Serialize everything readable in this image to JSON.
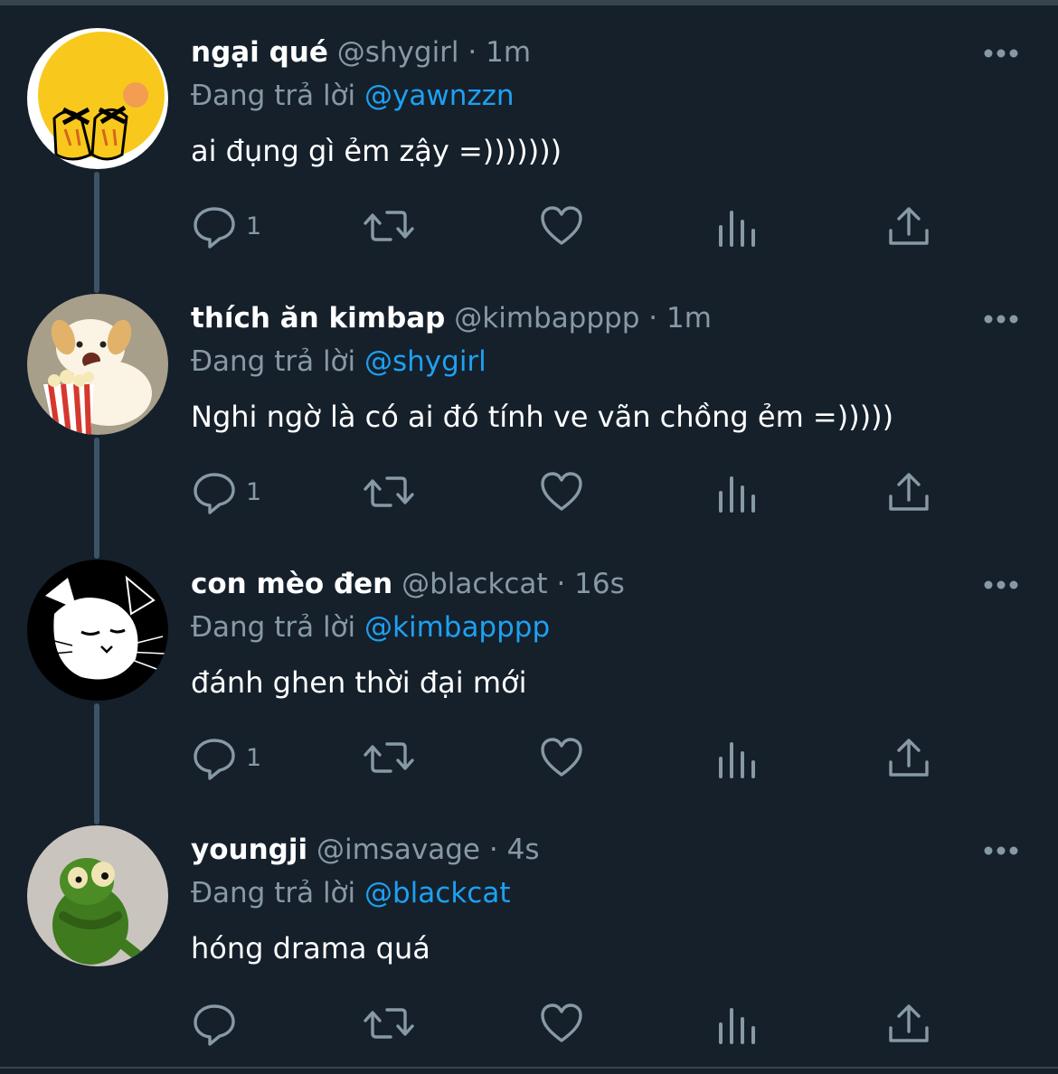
{
  "reply_prefix": "Đang trả lời",
  "tweets": [
    {
      "name": "ngại qué",
      "handle": "@shygirl",
      "sep": "·",
      "time": "1m",
      "reply_to": "@yawnzzn",
      "text": "ai đụng gì ẻm zậy =)))))))",
      "reply_count": "1",
      "avatar": "crying-emoji-avatar"
    },
    {
      "name": "thích ăn kimbap",
      "handle": "@kimbapppp",
      "sep": "·",
      "time": "1m",
      "reply_to": "@shygirl",
      "text": "Nghi ngờ là có ai đó tính ve vãn chồng ẻm =)))))",
      "reply_count": "1",
      "avatar": "puppy-popcorn-avatar"
    },
    {
      "name": "con mèo đen",
      "handle": "@blackcat",
      "sep": "·",
      "time": "16s",
      "reply_to": "@kimbapppp",
      "text": "đánh ghen thời đại mới",
      "reply_count": "1",
      "avatar": "black-white-cat-avatar"
    },
    {
      "name": "youngji",
      "handle": "@imsavage",
      "sep": "·",
      "time": "4s",
      "reply_to": "@blackcat",
      "text": "hóng drama quá",
      "reply_count": "",
      "avatar": "sad-green-frog-avatar"
    }
  ],
  "icons": {
    "reply": "reply-icon",
    "retweet": "retweet-icon",
    "like": "like-icon",
    "analytics": "analytics-icon",
    "share": "share-icon",
    "more": "more-icon"
  },
  "colors": {
    "background": "#15202b",
    "text": "#ffffff",
    "secondary": "#8899a6",
    "accent": "#1da1f2",
    "thread_line": "#3d5466"
  }
}
